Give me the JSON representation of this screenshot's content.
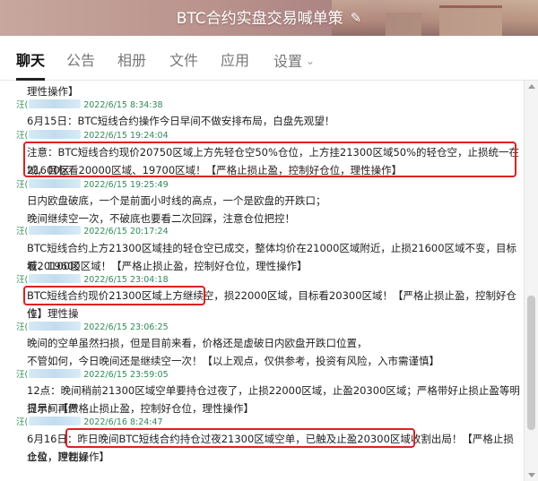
{
  "window": {
    "title": "BTC合约实盘交易喊单策"
  },
  "tabs": [
    {
      "label": "聊天",
      "active": true
    },
    {
      "label": "公告"
    },
    {
      "label": "相册"
    },
    {
      "label": "文件"
    },
    {
      "label": "应用"
    },
    {
      "label": "设置"
    }
  ],
  "messages": [
    {
      "text": "理性操作】"
    },
    {
      "sender": "汪(",
      "time": "2022/6/15 8:34:38",
      "lines": [
        "6月15日：BTC短线合约操作今日早间不做安排布局，白盘先观望！"
      ]
    },
    {
      "sender": "汪(",
      "time": "2022/6/15 19:24:04",
      "lines": [
        "注意：BTC短线合约现价20750区域上方先轻仓空50%仓位，上方挂21300区域50%的轻仓空，止损统一在21600区",
        "域，目标看20000区域、19700区域！【严格止损止盈，控制好仓位，理性操作】"
      ]
    },
    {
      "sender": "汪(",
      "time": "2022/6/15 19:25:49",
      "lines": [
        "日内欧盘破底，一个是前面小时线的高点，一个是欧盘的开跌口；",
        "晚间继续空一次，不破底也要看二次回踩，注意仓位把控！"
      ]
    },
    {
      "sender": "汪(",
      "time": "2022/6/15 20:17:24",
      "lines": [
        "BTC短线合约上方21300区域挂的轻仓空已成交，整体均价在21000区域附近，止损21600区域不变，目标看20100区",
        "域、19600区域！【严格止损止盈，控制好仓位，理性操作】"
      ]
    },
    {
      "sender": "汪(",
      "time": "2022/6/15 23:04:18",
      "lines": [
        "BTC短线合约现价21300区域上方继续空，损22000区域，目标看20300区域！【严格止损止盈，控制好仓位，理性操",
        "作】"
      ]
    },
    {
      "sender": "汪(",
      "time": "2022/6/15 23:06:25",
      "lines": [
        "晚间的空单虽然扫损，但是目前来看，价格还是虚破日内欧盘开跌口位置，",
        "不管如何，今日晚间还是继续空一次！【以上观点，仅供参考，投资有风险，入市需谨慎】"
      ]
    },
    {
      "sender": "汪(",
      "time": "2022/6/15 23:59:05",
      "lines": [
        "12点：晚间稍前21300区域空单要持仓过夜了，止损22000区域，止盈20300区域；严格带好止损止盈等明日早间再做",
        "提示！【严格止损止盈，控制好仓位，理性操作】"
      ]
    },
    {
      "sender": "汪(",
      "time": "2022/6/16 8:24:47",
      "lines": [
        "6月16日：昨日晚间BTC短线合约持仓过夜21300区域空单，已触及止盈20300区域收割出局！【严格止损止盈，控制好",
        "仓位，理性操作】"
      ]
    }
  ],
  "colors": {
    "highlight": "#e02020",
    "sender": "#2e8b57",
    "header": "#b9928c"
  },
  "icons": {
    "edit": "pencil-icon",
    "dropdown": "chevron-down-icon"
  }
}
